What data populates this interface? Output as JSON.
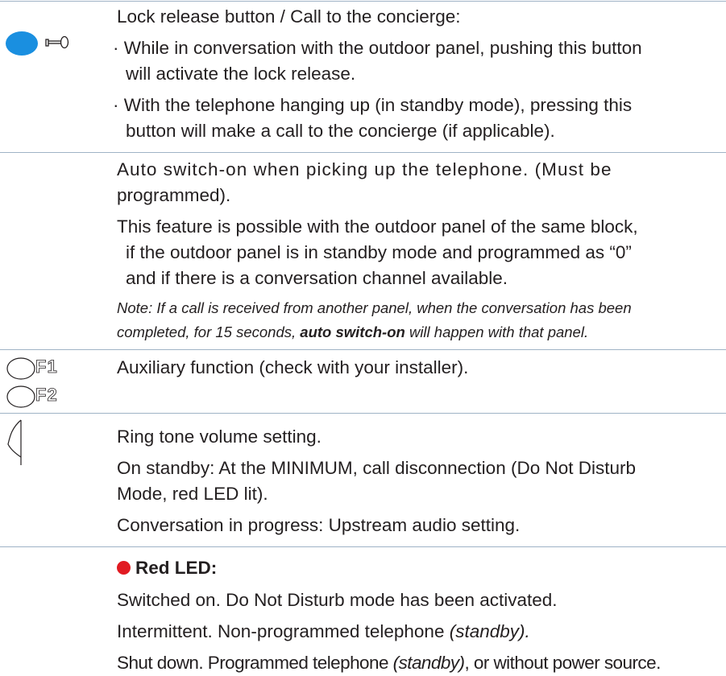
{
  "colors": {
    "rule": "#9fb3c6",
    "blue_button": "#1a8fe0",
    "red_led": "#e11b22",
    "text": "#231f20"
  },
  "section_lock": {
    "icon": "lock-release-button-with-key-icon",
    "title": "Lock release button / Call to the concierge:",
    "bullet1_line1": "· While in conversation with the outdoor panel, pushing this button",
    "bullet1_line2": "will activate the lock release.",
    "bullet2_line1": "· With the telephone hanging up (in standby mode), pressing this",
    "bullet2_line2": "button will make a call to the concierge (if applicable)."
  },
  "section_auto": {
    "line1": "Auto switch-on when picking up the telephone. (Must be",
    "line2": "programmed).",
    "para_line1": "This feature is possible with the outdoor panel of the same block,",
    "para_line2": "if the outdoor panel is in standby mode and programmed as “0”",
    "para_line3": "and if there is a conversation channel available.",
    "note_line1": "Note: If a call is received from another panel, when the conversation has been",
    "note_line2_pre": "completed, for 15 seconds, ",
    "note_line2_bold": "auto switch-on",
    "note_line2_post": " will happen with that panel."
  },
  "section_aux": {
    "f1_label": "F1",
    "f2_label": "F2",
    "text": "Auxiliary function (check with your installer)."
  },
  "section_volume": {
    "icon": "volume-dial-icon",
    "line1": "Ring tone volume setting.",
    "line2": "On standby: At the MINIMUM, call disconnection (Do Not Disturb",
    "line3": "Mode, red LED lit).",
    "line4": "Conversation in progress: Upstream audio setting."
  },
  "section_led": {
    "icon": "red-dot-icon",
    "title": "Red LED:",
    "line1": "Switched on. Do Not Disturb mode has been activated.",
    "line2_pre": "Intermittent. Non-programmed telephone ",
    "line2_ital": "(standby).",
    "line3_pre": "Shut down. Programmed telephone ",
    "line3_ital": "(standby)",
    "line3_post": ", or without power source."
  }
}
